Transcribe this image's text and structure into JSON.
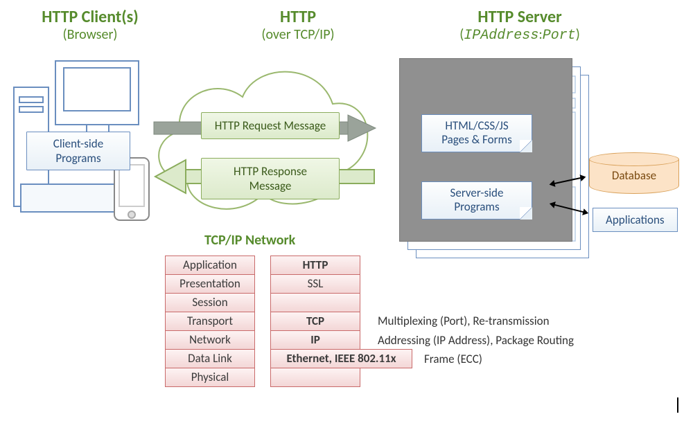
{
  "client": {
    "title": "HTTP Client(s)",
    "subtitle": "(Browser)",
    "box": "Client-side Programs"
  },
  "middle": {
    "title": "HTTP",
    "subtitle": "(over TCP/IP)",
    "request": "HTTP Request Message",
    "response": "HTTP Response Message",
    "stack_title": "TCP/IP Network"
  },
  "server": {
    "title": "HTTP Server",
    "subtitle_open": "(",
    "subtitle_addr": "IPAddress",
    "subtitle_sep": ":",
    "subtitle_port": "Port",
    "subtitle_close": ")",
    "pages": "HTML/CSS/JS Pages & Forms",
    "programs": "Server-side Programs",
    "database": "Database",
    "applications": "Applications"
  },
  "stack": {
    "layers": [
      "Application",
      "Presentation",
      "Session",
      "Transport",
      "Network",
      "Data Link",
      "Physical"
    ],
    "protocols": [
      "HTTP",
      "SSL",
      "",
      "TCP",
      "IP",
      "Ethernet, IEEE 802.11x",
      ""
    ],
    "notes": {
      "transport": "Multiplexing (Port), Re-transmission",
      "network": "Addressing (IP Address), Package Routing",
      "datalink": "Frame (ECC)"
    }
  }
}
